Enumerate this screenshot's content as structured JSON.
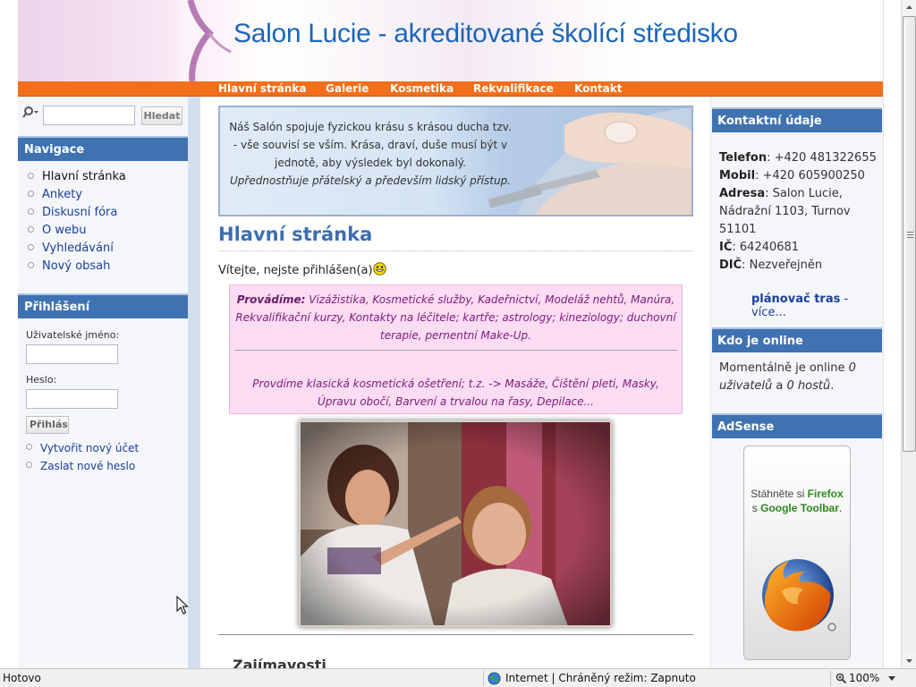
{
  "site": {
    "title": "Salon Lucie - akreditované školící středisko"
  },
  "nav": {
    "items": [
      "Hlavní stránka",
      "Galerie",
      "Kosmetika",
      "Rekvalifikace",
      "Kontakt"
    ]
  },
  "search": {
    "value": "",
    "button_label": "Hledat"
  },
  "sidebar": {
    "navigation_title": "Navigace",
    "navigation_items": [
      "Hlavní stránka",
      "Ankety",
      "Diskusní fóra",
      "O webu",
      "Vyhledávání",
      "Nový obsah"
    ],
    "login_title": "Přihlášení",
    "username_label": "Uživatelské jméno:",
    "password_label": "Heslo:",
    "login_button": "Přihlásit",
    "account_links": [
      "Vytvořit nový účet",
      "Zaslat nové heslo"
    ]
  },
  "banner": {
    "text": "Náš Salón spojuje fyzickou krásu s krásou ducha tzv. - vše souvisí se vším. Krása, draví, duše musí být v jednotě, aby výsledek byl dokonalý.",
    "text_italic": "Upřednostňuje přátelský a především lidský přístup."
  },
  "main": {
    "page_title": "Hlavní stránka",
    "welcome": "Vítejte, nejste přihlášen(a)",
    "services_lead": "Provádíme:",
    "services_list": "Vizážistika, Kosmetické služby, Kadeřnictví, Modeláž nehtů, Manúra, Rekvalifikační kurzy, Kontakty na léčitele; kartře; astrology; kineziology; duchovní terapie, pernentní Make-Up.",
    "services_detail": "Provdíme klasická kosmetická ošetření; t.z. -> Masáže, Čištění pleti, Masky, Úpravu obočí, Barvení a trvalou na řasy, Depilace...",
    "next_heading": "Zajímavosti"
  },
  "contact": {
    "title": "Kontaktní údaje",
    "phone_label": "Telefon",
    "phone": ": +420 481322655",
    "mobile_label": "Mobil",
    "mobile": ": +420 605900250",
    "address_label": "Adresa",
    "address": ": Salon Lucie, Nádražní 1103, Turnov 51101",
    "ic_label": "IČ",
    "ic": ": 64240681",
    "dic_label": "DIČ",
    "dic": ": Nezveřejněn",
    "route_link": "plánovač tras",
    "route_more": " - více..."
  },
  "online": {
    "title": "Kdo je online",
    "text_prefix": "Momentálně je online ",
    "users": "0 uživatelů",
    "text_mid": " a ",
    "guests": "0 hostů",
    "text_suffix": "."
  },
  "adsense": {
    "title": "AdSense",
    "line1_prefix": "Stáhněte si ",
    "line1_brand": "Firefox",
    "line2_prefix": "s ",
    "line2_brand": "Google Toolbar",
    "line2_suffix": "."
  },
  "statusbar": {
    "status": "Hotovo",
    "zone": "Internet | Chráněný režim: Zapnuto",
    "zoom": "100%"
  },
  "colors": {
    "nav_bar": "#f36f1c",
    "block_title": "#3f72b1",
    "site_title": "#1a66b8",
    "link": "#1a3e9a",
    "services_bg": "#fcdcf3"
  },
  "icons": {
    "search": "magnifier-icon",
    "smiley": "smiley-icon",
    "zone": "globe-icon",
    "zoom": "zoom-icon",
    "ad_logo": "firefox-logo-icon"
  }
}
